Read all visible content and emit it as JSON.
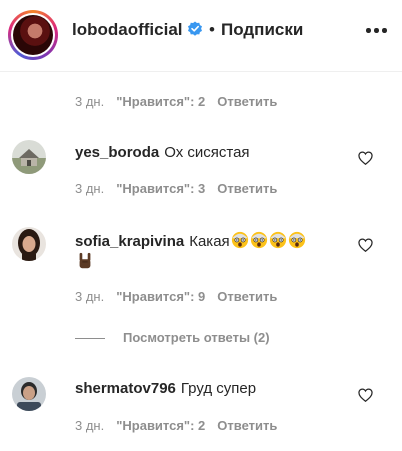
{
  "header": {
    "username": "lobodaofficial",
    "verified": true,
    "separator": "•",
    "follow_label": "Подписки",
    "more_icon": "more-horizontal-icon"
  },
  "top_meta": {
    "time": "3 дн.",
    "likes": "\"Нравится\": 2",
    "reply": "Ответить"
  },
  "comments": [
    {
      "username": "yes_boroda",
      "text": "Ох сисястая",
      "time": "3 дн.",
      "likes": "\"Нравится\": 3",
      "reply": "Ответить"
    },
    {
      "username": "sofia_krapivina",
      "text": "Какая",
      "emojis": [
        "shocked-face-emoji",
        "shocked-face-emoji",
        "shocked-face-emoji",
        "shocked-face-emoji",
        "sign-of-horns-emoji"
      ],
      "time": "3 дн.",
      "likes": "\"Нравится\": 9",
      "reply": "Ответить",
      "view_replies": "Посмотреть ответы (2)"
    },
    {
      "username": "shermatov796",
      "text": "Груд супер",
      "time": "3 дн.",
      "likes": "\"Нравится\": 2",
      "reply": "Ответить"
    }
  ],
  "colors": {
    "text": "#262626",
    "secondary": "#8e8e8e",
    "verified": "#3897f0",
    "divider": "#efefef"
  }
}
